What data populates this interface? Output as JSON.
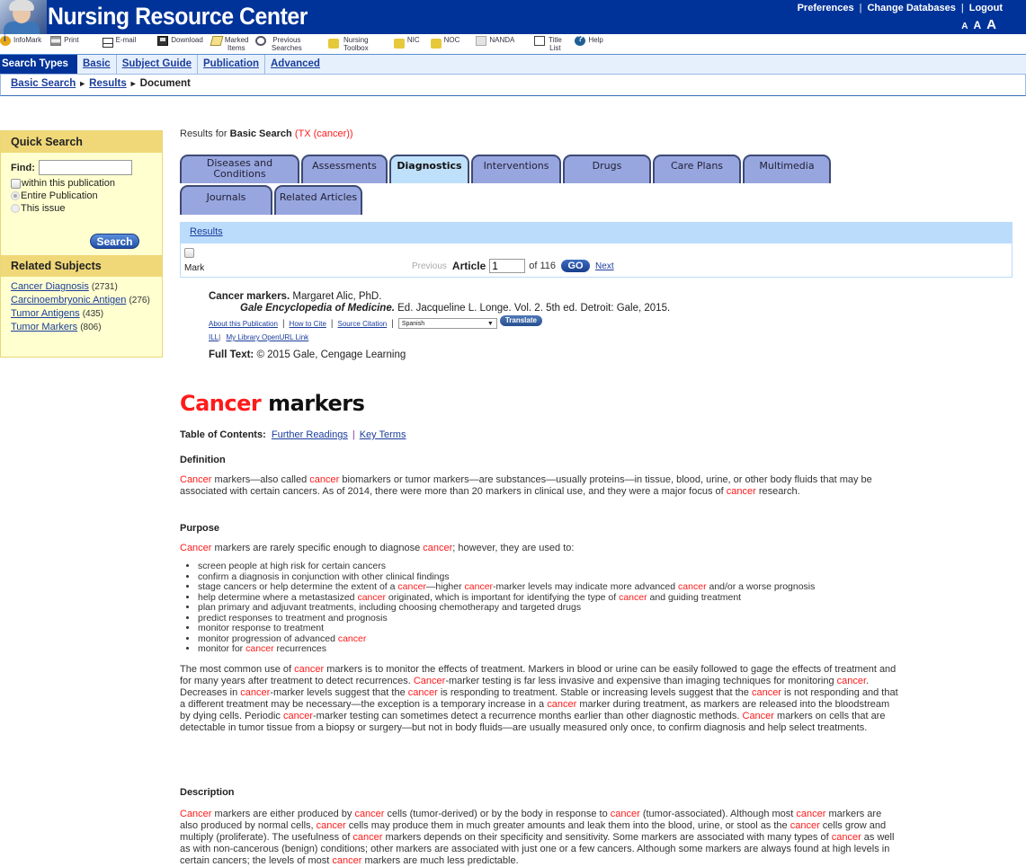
{
  "header": {
    "title": "Nursing Resource Center",
    "top_links": [
      "Preferences",
      "Change Databases",
      "Logout"
    ],
    "text_size": [
      "A",
      "A",
      "A"
    ]
  },
  "toolbar": {
    "items": [
      {
        "label": "InfoMark",
        "icon": "infomark-icon"
      },
      {
        "label": "Print",
        "icon": "print-icon"
      },
      {
        "label": "E-mail",
        "icon": "email-icon"
      },
      {
        "label": "Download",
        "icon": "download-icon"
      },
      {
        "label": "Marked Items",
        "icon": "marked-items-icon"
      },
      {
        "label": "Previous Searches",
        "icon": "previous-searches-icon"
      },
      {
        "label": "Nursing Toolbox",
        "icon": "key-icon"
      },
      {
        "label": "NIC",
        "icon": "key-icon"
      },
      {
        "label": "NOC",
        "icon": "key-icon"
      },
      {
        "label": "NANDA",
        "icon": "book-icon"
      },
      {
        "label": "Title List",
        "icon": "scroll-icon"
      },
      {
        "label": "Help",
        "icon": "help-icon"
      }
    ]
  },
  "search_nav": {
    "label": "Search Types",
    "tabs": [
      "Basic",
      "Subject Guide",
      "Publication",
      "Advanced"
    ]
  },
  "breadcrumb": {
    "items": [
      "Basic Search",
      "Results",
      "Document"
    ]
  },
  "sidebar": {
    "quick_search": {
      "heading": "Quick Search",
      "find_label": "Find:",
      "find_value": "",
      "within_label": "within this publication",
      "options": [
        "Entire Publication",
        "This issue"
      ],
      "selected_option": "Entire Publication",
      "search_button": "Search"
    },
    "related_subjects": {
      "heading": "Related Subjects",
      "items": [
        {
          "label": "Cancer Diagnosis",
          "count": "(2731)"
        },
        {
          "label": "Carcinoembryonic Antigen",
          "count": "(276)"
        },
        {
          "label": "Tumor Antigens",
          "count": "(435)"
        },
        {
          "label": "Tumor Markers",
          "count": "(806)"
        }
      ]
    }
  },
  "main": {
    "results_for": {
      "prefix": "Results for",
      "search_type": "Basic Search",
      "query": "(TX (cancer))"
    },
    "tabs_row1": [
      "Diseases and Conditions",
      "Assessments",
      "Diagnostics",
      "Interventions",
      "Drugs",
      "Care Plans",
      "Multimedia"
    ],
    "tabs_row2": [
      "Journals",
      "Related Articles"
    ],
    "active_tab": "Diagnostics",
    "results_link": "Results",
    "article_nav": {
      "mark_label": "Mark",
      "previous": "Previous",
      "article_label": "Article",
      "article_value": "1",
      "of_total": "of 116",
      "go": "GO",
      "next": "Next"
    },
    "citation": {
      "title": "Cancer markers.",
      "author": "Margaret Alic, PhD.",
      "source_title": "Gale Encyclopedia of Medicine.",
      "source_rest": "Ed. Jacqueline L. Longe. Vol. 2. 5th ed. Detroit: Gale, 2015.",
      "links": [
        "About this Publication",
        "How to Cite",
        "Source Citation"
      ],
      "language": "Spanish",
      "translate": "Translate",
      "links2": [
        "ILL",
        "My Library OpenURL Link"
      ],
      "fulltext_label": "Full Text:",
      "fulltext_value": "© 2015 Gale, Cengage Learning"
    },
    "document": {
      "title_highlight": "Cancer",
      "title_rest": "markers",
      "toc_label": "Table of Contents:",
      "toc_links": [
        "Further Readings",
        "Key Terms"
      ],
      "sections": {
        "definition": {
          "heading": "Definition",
          "html": "<span class=\"red\">Cancer</span> markers—also called <span class=\"red\">cancer</span> biomarkers or tumor markers—are substances—usually proteins—in tissue, blood, urine, or other body fluids that may be associated with certain cancers. As of 2014, there were more than 20 markers in clinical use, and they were a major focus of <span class=\"red\">cancer</span> research."
        },
        "purpose": {
          "heading": "Purpose",
          "intro_html": "<span class=\"red\">Cancer</span> markers are rarely specific enough to diagnose <span class=\"red\">cancer</span>; however, they are used to:",
          "bullets_html": [
            "screen people at high risk for certain cancers",
            "confirm a diagnosis in conjunction with other clinical findings",
            "stage cancers or help determine the extent of a <span class=\"red\">cancer</span>—higher <span class=\"red\">cancer</span>-marker levels may indicate more advanced <span class=\"red\">cancer</span> and/or a worse prognosis",
            "help determine where a metastasized <span class=\"red\">cancer</span> originated, which is important for identifying the type of <span class=\"red\">cancer</span> and guiding treatment",
            "plan primary and adjuvant treatments, including choosing chemotherapy and targeted drugs",
            "predict responses to treatment and prognosis",
            "monitor response to treatment",
            "monitor progression of advanced <span class=\"red\">cancer</span>",
            "monitor for <span class=\"red\">cancer</span> recurrences"
          ],
          "paragraph_html": "The most common use of <span class=\"red\">cancer</span> markers is to monitor the effects of treatment. Markers in blood or urine can be easily followed to gage the effects of treatment and for many years after treatment to detect recurrences. <span class=\"red\">Cancer</span>-marker testing is far less invasive and expensive than imaging techniques for monitoring <span class=\"red\">cancer</span>. Decreases in <span class=\"red\">cancer</span>-marker levels suggest that the <span class=\"red\">cancer</span> is responding to treatment. Stable or increasing levels suggest that the <span class=\"red\">cancer</span> is not responding and that a different treatment may be necessary—the exception is a temporary increase in a <span class=\"red\">cancer</span> marker during treatment, as markers are released into the bloodstream by dying cells. Periodic <span class=\"red\">cancer</span>-marker testing can sometimes detect a recurrence months earlier than other diagnostic methods. <span class=\"red\">Cancer</span> markers on cells that are detectable in tumor tissue from a biopsy or surgery—but not in body fluids—are usually measured only once, to confirm diagnosis and help select treatments."
        },
        "description": {
          "heading": "Description",
          "html": "<span class=\"red\">Cancer</span> markers are either produced by <span class=\"red\">cancer</span> cells (tumor-derived) or by the body in response to <span class=\"red\">cancer</span> (tumor-associated). Although most <span class=\"red\">cancer</span> markers are also produced by normal cells, <span class=\"red\">cancer</span> cells may produce them in much greater amounts and leak them into the blood, urine, or stool as the <span class=\"red\">cancer</span> cells grow and multiply (proliferate). The usefulness of <span class=\"red\">cancer</span> markers depends on their specificity and sensitivity. Some markers are associated with many types of <span class=\"red\">cancer</span> as well as with non-cancerous (benign) conditions; other markers are associated with just one or a few cancers. Although some markers are always found at high levels in certain cancers; the levels of most <span class=\"red\">cancer</span> markers are much less predictable."
        }
      }
    }
  }
}
